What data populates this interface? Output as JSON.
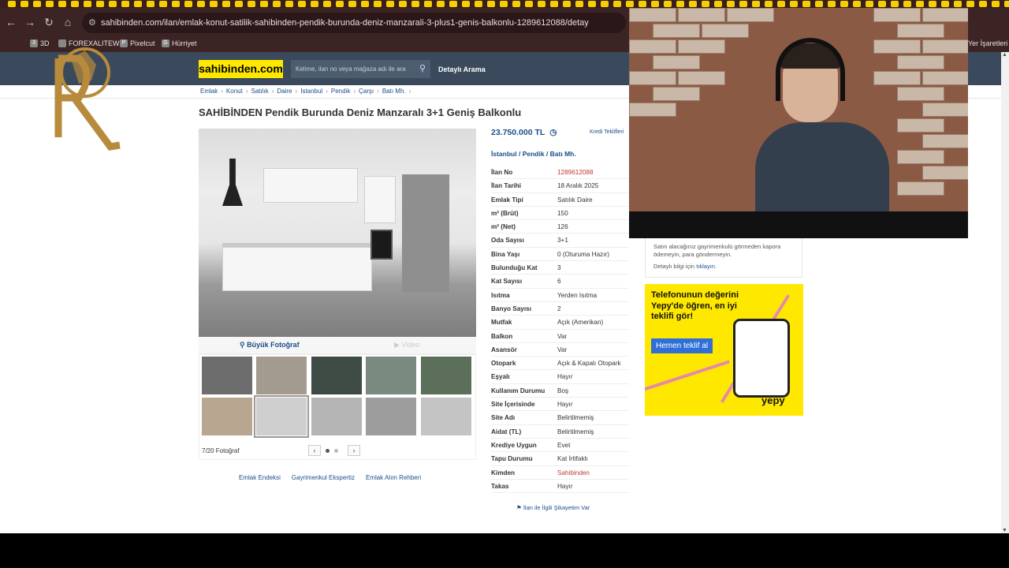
{
  "browser": {
    "url": "sahibinden.com/ilan/emlak-konut-satilik-sahibinden-pendik-burunda-deniz-manzarali-3-plus1-genis-balkonlu-1289612088/detay",
    "bookmarks": [
      {
        "label": "3D",
        "icon": "bookmark-icon"
      },
      {
        "label": "FOREXALITEW",
        "icon": "bookmark-icon"
      },
      {
        "label": "Pixelcut",
        "icon": "pixelcut-icon"
      },
      {
        "label": "Hürriyet",
        "icon": "hurriyet-icon"
      }
    ],
    "other_bookmarks": "Yer İşaretleri"
  },
  "header": {
    "logo": "sahibinden.com",
    "search_placeholder": "Kelime, ilan no veya mağaza adı ile ara",
    "detailed_search": "Detaylı Arama"
  },
  "breadcrumb": [
    "Emlak",
    "Konut",
    "Satılık",
    "Daire",
    "İstanbul",
    "Pendik",
    "Çarşı",
    "Batı Mh."
  ],
  "listing": {
    "title": "SAHİBİNDEN Pendik Burunda Deniz Manzaralı 3+1 Geniş Balkonlu",
    "price": "23.750.000 TL",
    "kredi": "Kredi Teklifleri",
    "location": [
      "İstanbul",
      "Pendik",
      "Batı Mh."
    ],
    "attributes": [
      {
        "k": "İlan No",
        "v": "1289612088",
        "red": true
      },
      {
        "k": "İlan Tarihi",
        "v": "18 Aralık 2025"
      },
      {
        "k": "Emlak Tipi",
        "v": "Satılık Daire"
      },
      {
        "k": "m² (Brüt)",
        "v": "150"
      },
      {
        "k": "m² (Net)",
        "v": "126"
      },
      {
        "k": "Oda Sayısı",
        "v": "3+1"
      },
      {
        "k": "Bina Yaşı",
        "v": "0 (Oturuma Hazır)"
      },
      {
        "k": "Bulunduğu Kat",
        "v": "3"
      },
      {
        "k": "Kat Sayısı",
        "v": "6"
      },
      {
        "k": "Isıtma",
        "v": "Yerden Isıtma"
      },
      {
        "k": "Banyo Sayısı",
        "v": "2"
      },
      {
        "k": "Mutfak",
        "v": "Açık (Amerikan)"
      },
      {
        "k": "Balkon",
        "v": "Var"
      },
      {
        "k": "Asansör",
        "v": "Var"
      },
      {
        "k": "Otopark",
        "v": "Açık & Kapalı Otopark"
      },
      {
        "k": "Eşyalı",
        "v": "Hayır"
      },
      {
        "k": "Kullanım Durumu",
        "v": "Boş"
      },
      {
        "k": "Site İçerisinde",
        "v": "Hayır"
      },
      {
        "k": "Site Adı",
        "v": "Belirtilmemiş"
      },
      {
        "k": "Aidat (TL)",
        "v": "Belirtilmemiş"
      },
      {
        "k": "Krediye Uygun",
        "v": "Evet"
      },
      {
        "k": "Tapu Durumu",
        "v": "Kat İrtifaklı"
      },
      {
        "k": "Kimden",
        "v": "Sahibinden",
        "red": true
      },
      {
        "k": "Takas",
        "v": "Hayır"
      }
    ],
    "complaint": "İlan ile İlgili Şikayetim Var"
  },
  "gallery": {
    "big_photo": "Büyük Fotoğraf",
    "video": "Video",
    "counter": "7/20 Fotoğraf",
    "active_index": 6
  },
  "bottom_links": [
    "Emlak Endeksi",
    "Gayrimenkul Ekspertiz",
    "Emlak Alım Rehberi"
  ],
  "safety": {
    "text": "Satın alacağınız gayrimenkulü görmeden kapora ödemeyin, para göndermeyin.",
    "more_prefix": "Detaylı bilgi için",
    "more_link": "tıklayın."
  },
  "ad": {
    "headline": "Telefonunun değerini Yepy'de öğren, en iyi teklifi gör!",
    "cta": "Hemen teklif al",
    "brand": "yepy"
  }
}
